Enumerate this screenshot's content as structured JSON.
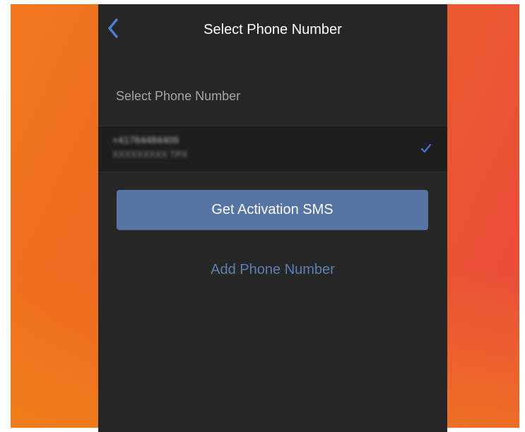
{
  "nav": {
    "title": "Select Phone Number",
    "back_icon": "chevron-left-icon"
  },
  "section": {
    "label": "Select Phone Number"
  },
  "phone_list": [
    {
      "number": "+41764484409",
      "subtitle": "XXXXXXXXX TPX",
      "selected": true,
      "check_icon": "checkmark-icon"
    }
  ],
  "actions": {
    "primary_label": "Get Activation SMS",
    "secondary_label": "Add Phone Number"
  },
  "colors": {
    "panel": "#262626",
    "row": "#1d1d1d",
    "accent": "#5574a3",
    "link": "#5d7fb0",
    "check": "#3f7ee0"
  }
}
